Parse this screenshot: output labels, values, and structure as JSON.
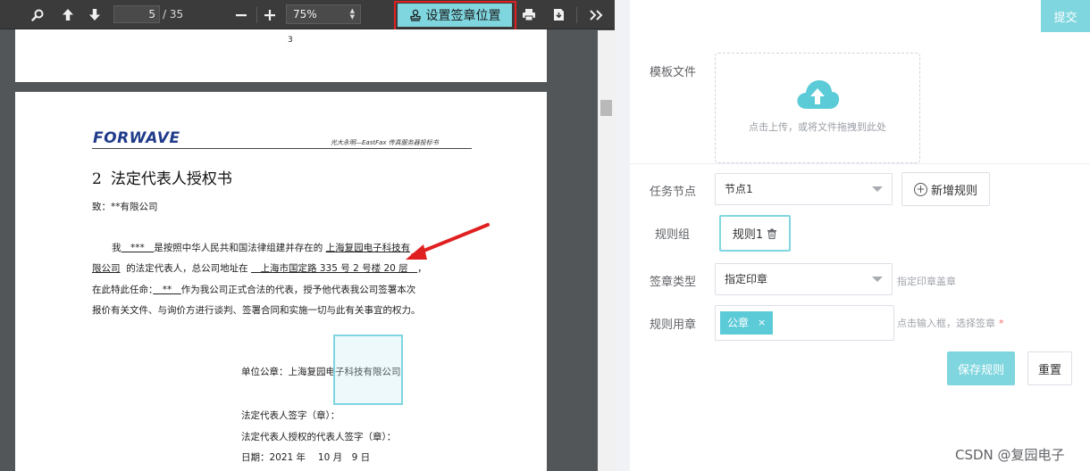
{
  "toolbar": {
    "page_current": "5",
    "page_total": "/ 35",
    "zoom": "75%",
    "sign_position_label": "设置签章位置",
    "icons": [
      "search-icon",
      "arrow-up-icon",
      "arrow-down-icon",
      "minus-icon",
      "plus-icon",
      "print-icon",
      "download-icon",
      "double-chevron-right-icon"
    ]
  },
  "pdf": {
    "prev_page_number": "3",
    "logo": "FORWAVE",
    "header_right": "光大永明—EastFax 传真服务器投标书",
    "section_number": "2",
    "section_title": "法定代表人授权书",
    "to_line": "致：**有限公司",
    "para": {
      "l1_a": "我",
      "l1_name": "　***　",
      "l1_b": "是按照中华人民共和国法律组建并存在的",
      "l1_company": "上海复园电子科技有",
      "l2_company": "限公司",
      "l2_b": "的法定代表人，总公司地址在",
      "l2_addr": "　上海市国定路 335 号 2 号楼 20 层　",
      "l2_c": "，",
      "l3_a": "在此特此任命：",
      "l3_name": "　**　",
      "l3_b": "作为我公司正式合法的代表，授予他代表我公司签署本次",
      "l4": "报价有关文件、与询价方进行谈判、签署合同和实施一切与此有关事宜的权力。"
    },
    "seal_line": "单位公章：上海复园电子科技有限公司",
    "sig1": "法定代表人签字（章）：",
    "sig2": "法定代表人授权的代表人签字（章）：",
    "date_line": "日期：2021 年　 10 月　9 日"
  },
  "form": {
    "submit_label": "提交",
    "template_label": "模板文件",
    "upload_hint": "点击上传，或将文件拖拽到此处",
    "task_node_label": "任务节点",
    "task_node_value": "节点1",
    "add_rule_label": "新增规则",
    "rule_group_label": "规则组",
    "rule_item": "规则1",
    "sign_type_label": "签章类型",
    "sign_type_value": "指定印章",
    "sign_type_hint": "指定印章盖章",
    "rule_seal_label": "规则用章",
    "seal_tag": "公章",
    "seal_hint": "点击输入框，选择签章",
    "required_mark": "*",
    "save_rule_label": "保存规则",
    "reset_label": "重置"
  },
  "watermark": "CSDN @复园电子",
  "colors": {
    "accent": "#7fd6df",
    "highlight_border": "#e02020",
    "toolbar_bg": "#3b3b3b",
    "viewer_bg": "#525659",
    "logo_blue": "#1f3b8a"
  }
}
